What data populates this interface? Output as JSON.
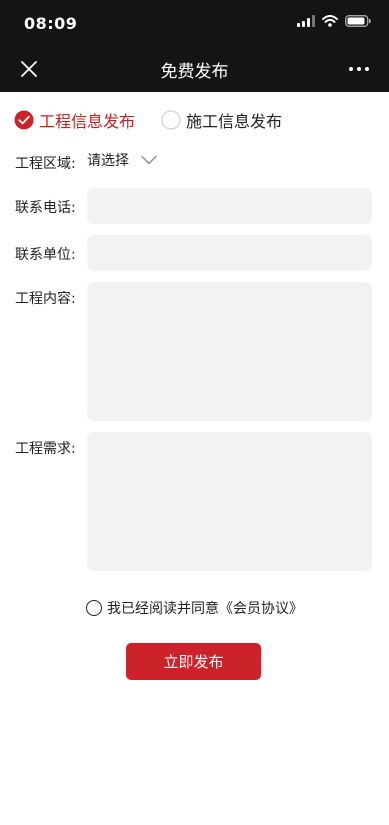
{
  "status_bar": {
    "time": "08:09"
  },
  "header": {
    "title": "免费发布"
  },
  "publish_types": [
    {
      "label": "工程信息发布",
      "selected": true
    },
    {
      "label": "施工信息发布",
      "selected": false
    }
  ],
  "form": {
    "region": {
      "label": "工程区域:",
      "value": "请选择"
    },
    "phone": {
      "label": "联系电话:",
      "value": ""
    },
    "company": {
      "label": "联系单位:",
      "value": ""
    },
    "content": {
      "label": "工程内容:",
      "value": ""
    },
    "demand": {
      "label": "工程需求:",
      "value": ""
    }
  },
  "agreement": {
    "text": "我已经阅读并同意《会员协议》",
    "checked": false
  },
  "submit": {
    "label": "立即发布"
  },
  "colors": {
    "accent": "#cc2229",
    "header_bg": "#141414",
    "input_bg": "#f3f2f2"
  }
}
